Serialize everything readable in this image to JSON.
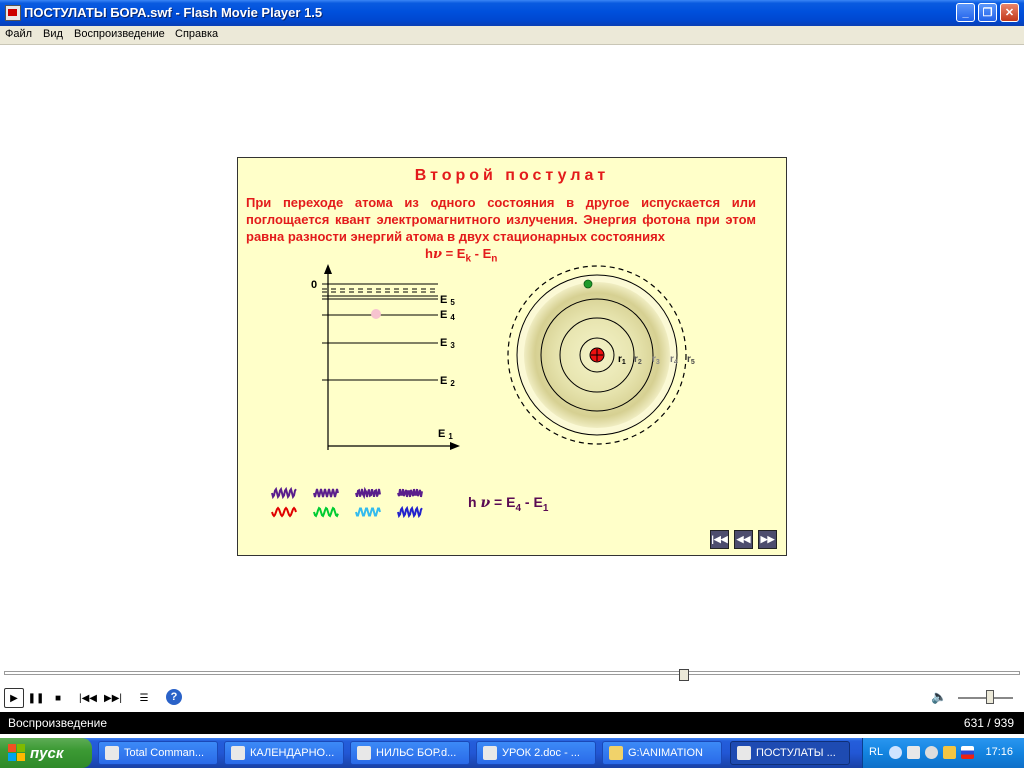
{
  "window": {
    "title": "ПОСТУЛАТЫ БОРА.swf - Flash Movie Player 1.5",
    "buttons": {
      "minimize": "_",
      "maximize": "❐",
      "close": "✕"
    }
  },
  "menu": [
    "Файл",
    "Вид",
    "Воспроизведение",
    "Справка"
  ],
  "slide": {
    "title": "Второй постулат",
    "text": "При переходе атома из одного состояния в другое испускается или поглощается квант электромагнитного излучения. Энергия фотона при этом равна разности энергий атома в двух стационарных состояниях",
    "formula_top": {
      "h": "h",
      "nu": "ν",
      "eq": " = E",
      "k": "k",
      "minus": " - E",
      "n": "n"
    },
    "formula_bottom": {
      "h": "h ",
      "nu": "ν",
      "eq": " = E",
      "k": "4",
      "minus": " - E",
      "n": "1"
    },
    "axis_zero": "0",
    "levels": [
      {
        "label": "E",
        "sub": "5"
      },
      {
        "label": "E",
        "sub": "4"
      },
      {
        "label": "E",
        "sub": "3"
      },
      {
        "label": "E",
        "sub": "2"
      },
      {
        "label": "E",
        "sub": "1"
      }
    ],
    "orbits": [
      {
        "label": "r",
        "sub": "1"
      },
      {
        "label": "r",
        "sub": "2"
      },
      {
        "label": "r",
        "sub": "3"
      },
      {
        "label": "r",
        "sub": "4"
      },
      {
        "label": "r",
        "sub": "5"
      }
    ],
    "wave_colors_top": [
      "#5a1e8c",
      "#5a1e8c",
      "#5a1e8c",
      "#5a1e8c"
    ],
    "wave_colors_bottom": [
      "#e00000",
      "#00cc33",
      "#33bbee",
      "#2222cc"
    ],
    "nav_buttons": {
      "first": "|◀◀",
      "prev": "◀◀",
      "next": "▶▶"
    }
  },
  "player": {
    "controls": {
      "play": "▶",
      "pause": "❚❚",
      "stop": "■",
      "prev": "|◀◀",
      "next": "▶▶|",
      "playlist": "☰",
      "help": "?"
    },
    "status_text": "Воспроизведение",
    "frame": "631",
    "total": "939"
  },
  "taskbar": {
    "start_label": "пуск",
    "tasks": [
      {
        "label": "Total Comman...",
        "color": "#e8e8e8"
      },
      {
        "label": "КАЛЕНДАРНО...",
        "color": "#e8e8e8"
      },
      {
        "label": "НИЛЬС БОР.d...",
        "color": "#e8e8e8"
      },
      {
        "label": "УРОК 2.doc - ...",
        "color": "#e8e8e8"
      },
      {
        "label": "G:\\ANIMATION",
        "color": "#f1d26a"
      },
      {
        "label": "ПОСТУЛАТЫ ...",
        "color": "#e8e8e8"
      }
    ],
    "tray_lang": "RL",
    "clock": "17:16"
  }
}
